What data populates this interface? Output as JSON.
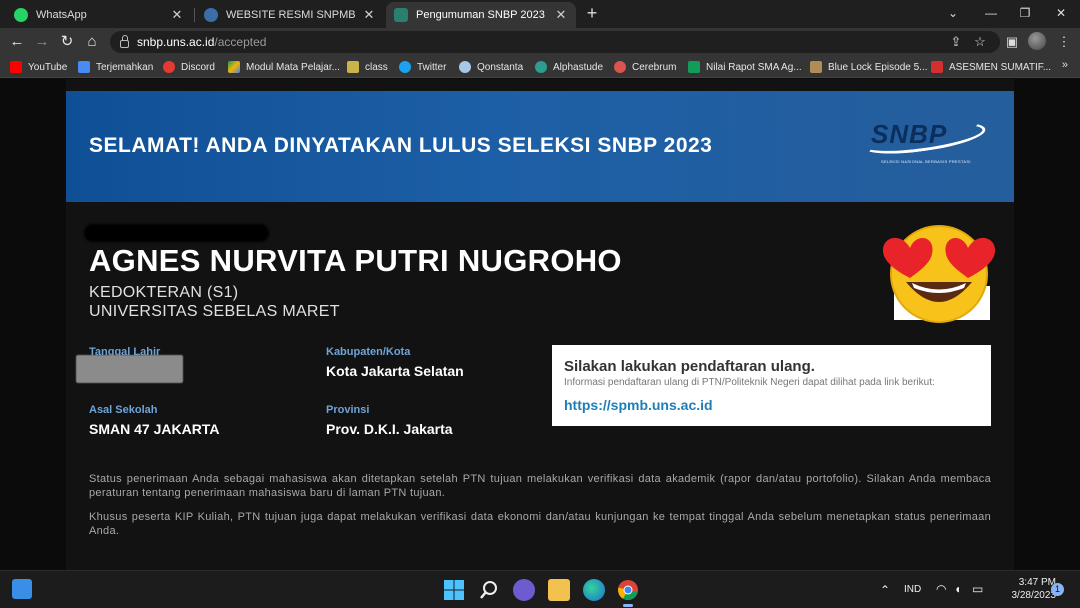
{
  "browser": {
    "tabs": [
      {
        "title": "WhatsApp",
        "icon": "whatsapp-icon",
        "color": "#25d366",
        "active": false
      },
      {
        "title": "WEBSITE RESMI SNPMB",
        "icon": "snpmb-icon",
        "color": "#3b6ea8",
        "active": false
      },
      {
        "title": "Pengumuman SNBP 2023",
        "icon": "snbp-icon",
        "color": "#2a7f6f",
        "active": true
      }
    ],
    "url_host": "snbp.uns.ac.id",
    "url_path": "/accepted",
    "bookmarks": [
      {
        "label": "YouTube",
        "icon": "youtube-icon",
        "color": "#ff0000"
      },
      {
        "label": "Terjemahkan",
        "icon": "translate-icon",
        "color": "#4a8af4"
      },
      {
        "label": "Discord",
        "icon": "discord-icon",
        "color": "#e53935"
      },
      {
        "label": "Modul Mata Pelajar...",
        "icon": "drive-icon",
        "color": "#f4b400"
      },
      {
        "label": "class",
        "icon": "classroom-icon",
        "color": "#c9b44a"
      },
      {
        "label": "Twitter",
        "icon": "twitter-icon",
        "color": "#1da1f2"
      },
      {
        "label": "Qonstanta",
        "icon": "qonstanta-icon",
        "color": "#a7c7e7"
      },
      {
        "label": "Alphastude",
        "icon": "alphastude-icon",
        "color": "#2e9c8f"
      },
      {
        "label": "Cerebrum",
        "icon": "cerebrum-icon",
        "color": "#d9534f"
      },
      {
        "label": "Nilai Rapot SMA Ag...",
        "icon": "sheets-icon",
        "color": "#0f9d58"
      },
      {
        "label": "Blue Lock Episode 5...",
        "icon": "bluelock-icon",
        "color": "#b08d57"
      },
      {
        "label": "ASESMEN SUMATIF...",
        "icon": "asesmen-icon",
        "color": "#d32f2f"
      }
    ]
  },
  "banner": {
    "title": "SELAMAT! ANDA DINYATAKAN LULUS SELEKSI SNBP 2023",
    "logo_text": "SNBP",
    "logo_sub": "SELEKSI NASIONAL BERBASIS PRESTASI"
  },
  "student": {
    "name": "AGNES NURVITA PUTRI NUGROHO",
    "program": "KEDOKTERAN (S1)",
    "university": "UNIVERSITAS SEBELAS MARET",
    "dob_label": "Tanggal Lahir",
    "regency_label": "Kabupaten/Kota",
    "regency": "Kota Jakarta Selatan",
    "school_label": "Asal Sekolah",
    "school": "SMAN 47 JAKARTA",
    "province_label": "Provinsi",
    "province": "Prov. D.K.I. Jakarta"
  },
  "registration": {
    "title": "Silakan lakukan pendaftaran ulang.",
    "desc": "Informasi pendaftaran ulang di PTN/Politeknik Negeri dapat dilihat pada link berikut:",
    "link": "https://spmb.uns.ac.id"
  },
  "notes": [
    "Status penerimaan Anda sebagai mahasiswa akan ditetapkan setelah PTN tujuan melakukan verifikasi data akademik (rapor dan/atau portofolio). Silakan Anda membaca peraturan tentang penerimaan mahasiswa baru di laman PTN tujuan.",
    "Khusus peserta KIP Kuliah, PTN tujuan juga dapat melakukan verifikasi data ekonomi dan/atau kunjungan ke tempat tinggal Anda sebelum menetapkan status penerimaan Anda."
  ],
  "taskbar": {
    "language": "IND",
    "time": "3:47 PM",
    "date": "3/28/2023",
    "notifications": "1"
  },
  "colors": {
    "banner": "#1a5aa0",
    "label": "#6fa4d8",
    "link": "#1e7fb6"
  }
}
